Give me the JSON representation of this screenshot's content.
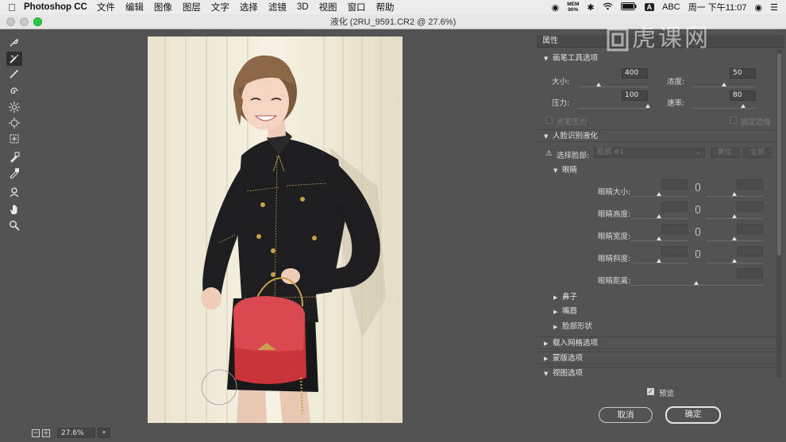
{
  "menubar": {
    "app_name": "Photoshop CC",
    "items": [
      "文件",
      "编辑",
      "图像",
      "图层",
      "文字",
      "选择",
      "滤镜",
      "3D",
      "视图",
      "窗口",
      "帮助"
    ],
    "mem_label": "MEM",
    "mem_value": "90%",
    "input_method": "A",
    "input_label": "ABC",
    "clock": "周一 下午11:07"
  },
  "window": {
    "title": "液化 (2RU_9591.CR2 @ 27.6%)"
  },
  "zoom": {
    "value": "27.6%"
  },
  "panel": {
    "title": "属性",
    "brush_section": {
      "title": "画笔工具选项",
      "size_label": "大小:",
      "size_value": "400",
      "density_label": "浓度:",
      "density_value": "50",
      "pressure_label": "压力:",
      "pressure_value": "100",
      "rate_label": "速率:",
      "rate_value": "80",
      "stylus_label": "光笔压力",
      "pin_edges_label": "固定边缘",
      "size_level": 0.3,
      "density_level": 0.5,
      "pressure_level": 1.0,
      "rate_level": 0.8
    },
    "face_section": {
      "title": "人脸识别液化",
      "select_face_label": "选择脸部:",
      "select_face_value": "脸部 #1",
      "reset_label": "复位",
      "all_label": "全部",
      "eyes_title": "眼睛",
      "eye_rows": [
        {
          "label": "眼睛大小:"
        },
        {
          "label": "眼睛高度:"
        },
        {
          "label": "眼睛宽度:"
        },
        {
          "label": "眼睛斜度:"
        }
      ],
      "eye_distance_label": "眼睛距离:",
      "nose_title": "鼻子",
      "mouth_title": "嘴唇",
      "face_shape_title": "脸部形状"
    },
    "mesh_section": {
      "title": "载入网格选项"
    },
    "mask_section": {
      "title": "蒙版选项"
    },
    "view_section": {
      "title": "视图选项"
    }
  },
  "footer": {
    "preview_label": "预览",
    "cancel_label": "取消",
    "ok_label": "确定"
  },
  "watermark": {
    "text": "虎课网"
  },
  "colors": {
    "panel_bg": "#535353",
    "jacket": "#1d1d1f",
    "bag": "#c9333a",
    "wall": "#f2ecdb"
  }
}
